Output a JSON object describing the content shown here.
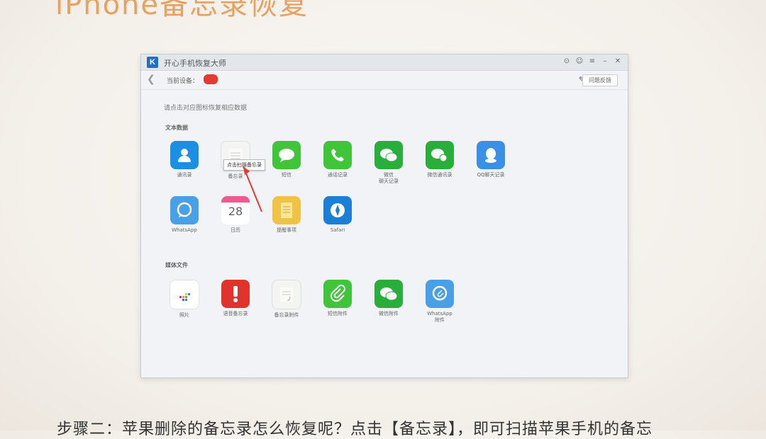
{
  "slide": {
    "title": "iPhone备忘录恢复",
    "caption": "步骤二：苹果删除的备忘录怎么恢复呢？点击【备忘录】，即可扫描苹果手机的备忘"
  },
  "window": {
    "title": "开心手机恢复大师",
    "logo": "K",
    "controls": [
      "⊙",
      "☺",
      "≡",
      "–",
      "✕"
    ],
    "device_label": "当前设备：",
    "feedback": "问题反馈",
    "hint": "请点击对应图标恢复相应数据"
  },
  "sections": {
    "text_data": "文本数据",
    "media_files": "媒体文件"
  },
  "text_apps": [
    {
      "label": "通讯录",
      "icon": "contacts-icon",
      "color": "#1a8fe3"
    },
    {
      "label": "备忘录",
      "icon": "notes-icon",
      "color": "#f4f4f2"
    },
    {
      "label": "短信",
      "icon": "messages-icon",
      "color": "#3fc43a"
    },
    {
      "label": "通话记录",
      "icon": "phone-icon",
      "color": "#3fc43a"
    },
    {
      "label": "微信\n聊天记录",
      "icon": "wechat-icon",
      "color": "#2aae3b"
    },
    {
      "label": "微信通讯录",
      "icon": "wechat-contacts-icon",
      "color": "#2aae3b"
    },
    {
      "label": "QQ聊天记录",
      "icon": "qq-icon",
      "color": "#3a8fe6"
    },
    {
      "label": "WhatsApp",
      "icon": "whatsapp-icon",
      "color": "#4aa0e6"
    },
    {
      "label": "日历",
      "icon": "calendar-icon",
      "color": "#ffffff",
      "calendar_day": "28"
    },
    {
      "label": "提醒事项",
      "icon": "reminders-icon",
      "color": "#f0c245"
    },
    {
      "label": "Safari",
      "icon": "safari-icon",
      "color": "#1b7fd6"
    }
  ],
  "media_apps": [
    {
      "label": "照片",
      "icon": "photos-icon",
      "color": "#ffffff"
    },
    {
      "label": "语音备忘录",
      "icon": "voice-memo-icon",
      "color": "#e0332c"
    },
    {
      "label": "备忘录附件",
      "icon": "notes-attachment-icon",
      "color": "#f4f4f2"
    },
    {
      "label": "短信附件",
      "icon": "attachment-icon",
      "color": "#3fc43a"
    },
    {
      "label": "微信附件",
      "icon": "wechat-attachment-icon",
      "color": "#2aae3b"
    },
    {
      "label": "WhatsApp\n附件",
      "icon": "whatsapp-attachment-icon",
      "color": "#4aa0e6"
    }
  ],
  "tooltip": "点击扫描备忘录"
}
